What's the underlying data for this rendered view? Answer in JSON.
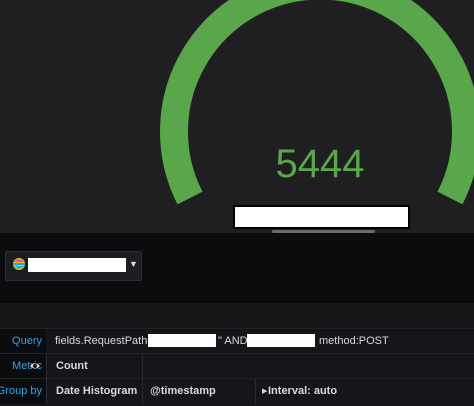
{
  "gauge": {
    "value": "5444",
    "color": "#5aa64b",
    "track_color": "#2a2b30"
  },
  "datasource": {
    "icon": "elasticsearch-icon"
  },
  "query_rows": [
    {
      "label": "Query",
      "text_1": "fields.RequestPath=\"",
      "text_2": "\" AND",
      "text_3": "method:POST"
    },
    {
      "label": "Metric",
      "value": "Count"
    },
    {
      "label": "Group by",
      "type": "Date Histogram",
      "field": "@timestamp",
      "interval": "Interval: auto"
    }
  ],
  "colors": {
    "label": "#33a2e5",
    "background": "#141619"
  }
}
